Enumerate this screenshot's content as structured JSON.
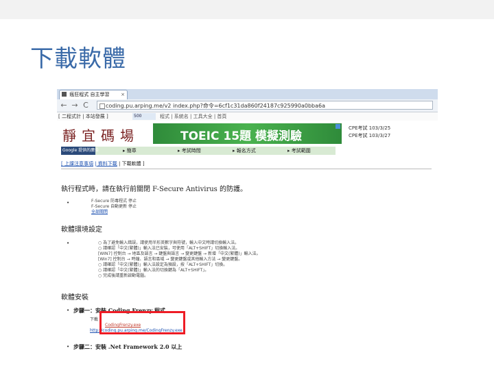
{
  "slide": {
    "title": "下載軟體"
  },
  "browser": {
    "tab_title": "瘋狂程式 自主學習",
    "tab_close": "×",
    "nav": {
      "back": "←",
      "forward": "→",
      "reload": "C"
    },
    "url": "coding.pu.arping.me/v2 index.php?命令=6cf1c31da860f24187c925990a0bba6a",
    "bookmarks_left": "[ 二程式計 | 本站發展 ]",
    "bookmark_badge": "500",
    "bookmarks_right": "程式 | 系統名 | 工具大全 | 首頁"
  },
  "page": {
    "logo_text": "靜宜碼場",
    "banner_text": "TOEIC 15題 模擬測驗",
    "cpe_lines": [
      "CPE考試 103/3/25",
      "CPE考試 103/3/27"
    ],
    "google_label": "Google 提供的廣告",
    "menu_items": [
      "▸ 簡章",
      "▸ 考試時間",
      "▸ 報名方式",
      "▸ 考試範圍"
    ],
    "breadcrumb": {
      "link1": "[ 上課注意事項",
      "link2": "| 資料下載",
      "current": "| 下載軟體 ]"
    },
    "notice": "執行程式時，請在執行前關閉 F-Secure Antivirus 的防護。",
    "notice_items": [
      "F-Secure 防毒程式 停止",
      "F-Secure 自動更新 停止",
      "全部關閉"
    ],
    "section_env": "軟體環境設定",
    "env_lines": [
      "○ 為了避免輸入錯誤，請使用半形英數字與符號，輸入中文時請切換輸入法。",
      "○ 請確認「中文(繁體)」輸入法已安裝，可使用「ALT+SHIFT」切換輸入法。",
      "   [WIN7] 控制台 → 地區及語言 → 鍵盤與語言 → 變更鍵盤 → 新增「中文(繁體)」輸入法。",
      "   [Win7] 控制台 → 時鐘、語言和區域 → 變更鍵盤或其他輸入方法 → 變更鍵盤。",
      "○ 請確認「中文(繁體)」輸入法設定為預設，按「ALT+SHIFT」切換。",
      "○ 請確認「中文(繁體)」輸入法的切換鍵為「ALT+SHIFT」。",
      "○ 完成後請重新啟動電腦。"
    ],
    "section_install": "軟體安裝",
    "step1": "步驟一：安裝 Coding Frenzy 程式",
    "step1_lines": [
      "下載",
      "CodingFrenzy.exe",
      "http://coding.pu.arping.me/CodingFrenzy.exe"
    ],
    "step2": "步驟二：安裝 .Net Framework 2.0 以上"
  }
}
